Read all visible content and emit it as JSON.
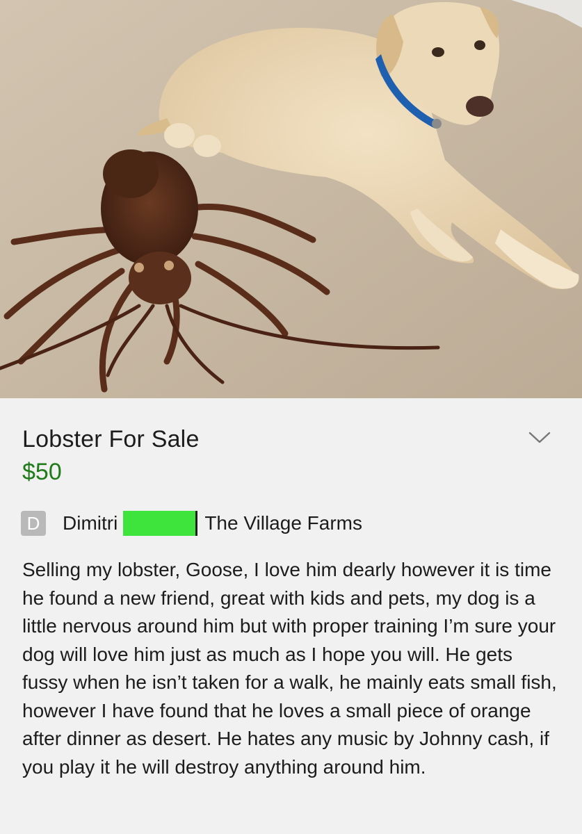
{
  "photo": {
    "subject": "dog-and-lobster-photo"
  },
  "listing": {
    "title": "Lobster For Sale",
    "price": "$50",
    "seller_initial": "D",
    "seller_name": "Dimitri",
    "location": "The Village Farms",
    "description": "Selling my lobster, Goose, I love him dearly however it is time he found a new friend, great with kids and pets, my dog is a little nervous around him but with proper training I’m sure your dog will love him just as much as I hope you will. He gets fussy when he isn’t taken for a walk, he mainly eats small fish, however I have found that he loves a small piece of orange after dinner as desert. He hates any music by Johnny cash, if you play it he will destroy anything around him."
  },
  "colors": {
    "price": "#1f7a1a",
    "redaction": "#3ee43c",
    "avatar_bg": "#b9b9b9"
  },
  "icons": {
    "expand": "chevron-down-icon"
  }
}
